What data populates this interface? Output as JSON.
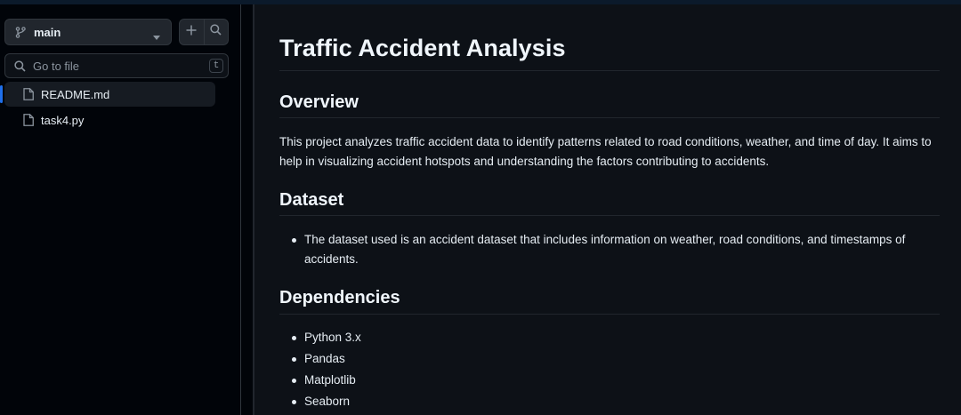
{
  "sidebar": {
    "branch": "main",
    "search_placeholder": "Go to file",
    "search_shortcut": "t",
    "files": [
      {
        "name": "README.md",
        "active": true
      },
      {
        "name": "task4.py",
        "active": false
      }
    ]
  },
  "readme": {
    "title": "Traffic Accident Analysis",
    "overview_heading": "Overview",
    "overview_text": "This project analyzes traffic accident data to identify patterns related to road conditions, weather, and time of day. It aims to help in visualizing accident hotspots and understanding the factors contributing to accidents.",
    "dataset_heading": "Dataset",
    "dataset_items": [
      "The dataset used is an accident dataset that includes information on weather, road conditions, and timestamps of accidents."
    ],
    "dependencies_heading": "Dependencies",
    "dependencies_items": [
      "Python 3.x",
      "Pandas",
      "Matplotlib",
      "Seaborn"
    ]
  },
  "icons": {
    "branch": "git-branch-icon",
    "caret": "triangle-down-icon",
    "plus": "plus-icon",
    "search": "search-icon",
    "file": "file-icon"
  },
  "colors": {
    "background": "#0d1117",
    "sidebar": "#010409",
    "text": "#e6edf3",
    "accent": "#1f6feb"
  }
}
